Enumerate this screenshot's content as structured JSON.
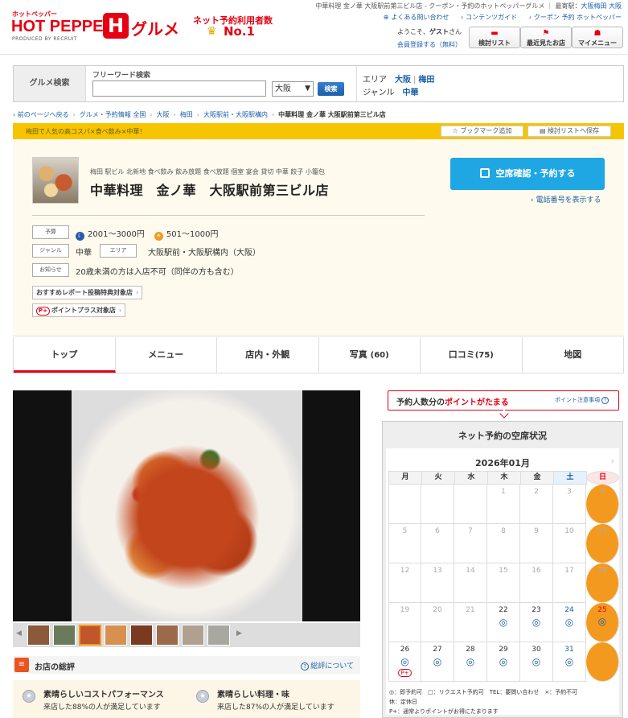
{
  "header": {
    "logo_small": "ホットペッパー",
    "logo_big": "HOT PEPPER",
    "logo_box": "H",
    "logo_gourmet": "グルメ",
    "produced_by": "PRODUCED BY RECRUIT",
    "no1_top": "ネット予約利用者数",
    "no1_text": "No.1",
    "top_line_prefix": "中華料理 金ノ華 大阪駅前第三ビル店 - クーポン・予約のホットペッパーグルメ ｜ 最寄駅：",
    "top_line_station": "大阪梅田 大阪",
    "links": [
      "よくある問い合わせ",
      "コンテンツガイド",
      "クーポン 予約 ホットペッパー"
    ],
    "welcome_prefix": "ようこそ、",
    "welcome_name": "ゲスト",
    "welcome_suffix": "さん",
    "register": "会員登録する（無料）",
    "buttons": [
      "検討リスト",
      "最近見たお店",
      "マイメニュー"
    ]
  },
  "search": {
    "label": "グルメ検索",
    "freeword_label": "フリーワード検索",
    "freeword_value": "",
    "area_selected": "大阪",
    "button": "検索",
    "area_label": "エリア",
    "area_values": [
      "大阪",
      "梅田"
    ],
    "genre_label": "ジャンル",
    "genre_value": "中華"
  },
  "breadcrumb": {
    "back": "前のページへ戻る",
    "items": [
      "グルメ・予約情報 全国",
      "大阪",
      "梅田",
      "大阪駅前・大阪駅構内"
    ],
    "current": "中華料理 金ノ華 大阪駅前第三ビル店"
  },
  "shop": {
    "catch": "梅田で人気の高コスパ×食べ飲み×中華！",
    "bookmark": "ブックマーク追加",
    "save_list": "検討リストへ保存",
    "tags": "梅田 駅ビル 北新地 食べ飲み 飲み放題 食べ放題 個室 宴会 貸切 中華 餃子 小籠包",
    "name": "中華料理　金ノ華　大阪駅前第三ビル店",
    "reserve": "空席確認・予約する",
    "phone": "電話番号を表示する",
    "budget_label": "予算",
    "budget_dinner": "2001～3000円",
    "budget_lunch": "501～1000円",
    "genre_label": "ジャンル",
    "genre": "中華",
    "area_label": "エリア",
    "area": "大阪駅前・大阪駅構内（大阪）",
    "notice_label": "お知らせ",
    "notice": "20歳未満の方は入店不可（同伴の方も含む）",
    "badge1": "おすすめレポート投稿特典対象店",
    "badge2": "ポイントプラス対象店",
    "pplus_mark": "P+"
  },
  "tabs": [
    {
      "label": "トップ",
      "count": ""
    },
    {
      "label": "メニュー",
      "count": ""
    },
    {
      "label": "店内・外観",
      "count": ""
    },
    {
      "label": "写真",
      "count": "(60)"
    },
    {
      "label": "口コミ",
      "count": "(75)"
    },
    {
      "label": "地図",
      "count": ""
    }
  ],
  "review": {
    "title": "お店の総評",
    "about": "総評について",
    "items": [
      {
        "title": "素晴らしいコストパフォーマンス",
        "sub": "来店した88%の人が満足しています"
      },
      {
        "title": "素晴らしい料理・味",
        "sub": "来店した87%の人が満足しています"
      }
    ]
  },
  "points": {
    "text_prefix": "予約人数分の",
    "text_red": "ポイントがたまる",
    "link": "ポイント注意事項"
  },
  "calendar": {
    "title": "ネット予約の空席状況",
    "month": "2026年01月",
    "dow": [
      "月",
      "火",
      "水",
      "木",
      "金",
      "土",
      "日"
    ],
    "weeks": [
      [
        null,
        null,
        null,
        {
          "d": "1"
        },
        {
          "d": "2"
        },
        {
          "d": "3"
        },
        {
          "d": "4"
        }
      ],
      [
        {
          "d": "5"
        },
        {
          "d": "6"
        },
        {
          "d": "7"
        },
        {
          "d": "8"
        },
        {
          "d": "9"
        },
        {
          "d": "10"
        },
        {
          "d": "11"
        }
      ],
      [
        {
          "d": "12"
        },
        {
          "d": "13"
        },
        {
          "d": "14"
        },
        {
          "d": "15"
        },
        {
          "d": "16"
        },
        {
          "d": "17"
        },
        {
          "d": "18"
        }
      ],
      [
        {
          "d": "19"
        },
        {
          "d": "20"
        },
        {
          "d": "21"
        },
        {
          "d": "22",
          "mark": "◎"
        },
        {
          "d": "23",
          "mark": "◎"
        },
        {
          "d": "24",
          "mark": "◎"
        },
        {
          "d": "25",
          "mark": "◎"
        }
      ],
      [
        {
          "d": "26",
          "mark": "◎",
          "pp": "P+"
        },
        {
          "d": "27",
          "mark": "◎"
        },
        {
          "d": "28",
          "mark": "◎"
        },
        {
          "d": "29",
          "mark": "◎"
        },
        {
          "d": "30",
          "mark": "◎"
        },
        {
          "d": "31",
          "mark": "◎"
        },
        null
      ]
    ],
    "legend1": "◎：即予約可　□：リクエスト予約可　TEL：要問い合わせ　×：予約不可",
    "legend2": "休：定休日",
    "legend3": "P+：通常よりポイントがお得にたまります"
  },
  "colors": {
    "brand_red": "#e60012",
    "accent_yellow": "#f7c400",
    "reserve_blue": "#1fa7e3",
    "link_blue": "#1b5fa8"
  }
}
